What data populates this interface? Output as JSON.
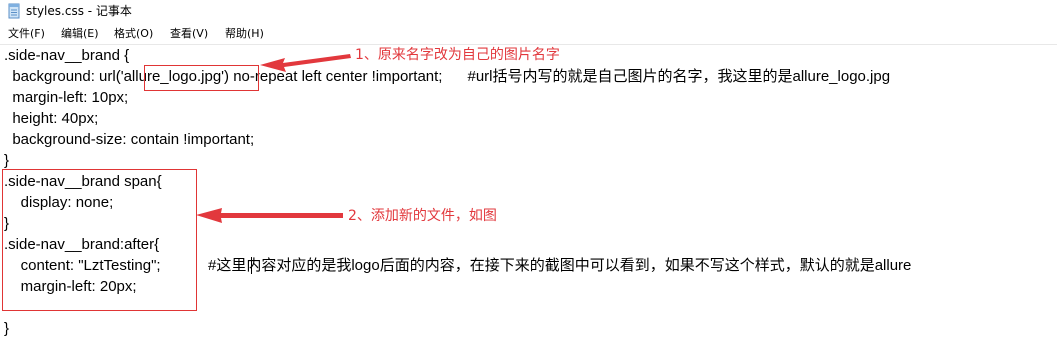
{
  "window": {
    "title": "styles.css - 记事本"
  },
  "menu": {
    "items": [
      {
        "label": "文件(F)"
      },
      {
        "label": "编辑(E)"
      },
      {
        "label": "格式(O)"
      },
      {
        "label": "查看(V)"
      },
      {
        "label": "帮助(H)"
      }
    ]
  },
  "editor": {
    "line1": ".side-nav__brand {",
    "line2_prefix": "  background: url('",
    "line2_highlight": "allure_logo.jpg",
    "line2_suffix": "') no-repeat left center !important;      ",
    "line2_comment": "#url括号内写的就是自己图片的名字，我这里的是allure_logo.jpg",
    "line3": "  margin-left: 10px;",
    "line4": "  height: 40px;",
    "line5": "  background-size: contain !important;",
    "line6": "}",
    "line7": ".side-nav__brand span{",
    "line8": "    display: none;",
    "line9": "}",
    "line10": ".side-nav__brand:after{",
    "line11_code": "    content: \"LztTesting\";",
    "line11_comment": "#这里内容对应的是我logo后面的内容，在接下来的截图中可以看到，如果不写这个样式，默认的就是allure",
    "line12": "    margin-left: 20px;",
    "line13": "",
    "line14": "}"
  },
  "annotations": {
    "note1": "1、原来名字改为自己的图片名字",
    "note2": "2、添加新的文件，如图"
  },
  "colors": {
    "annotation_red": "#e2383d"
  }
}
